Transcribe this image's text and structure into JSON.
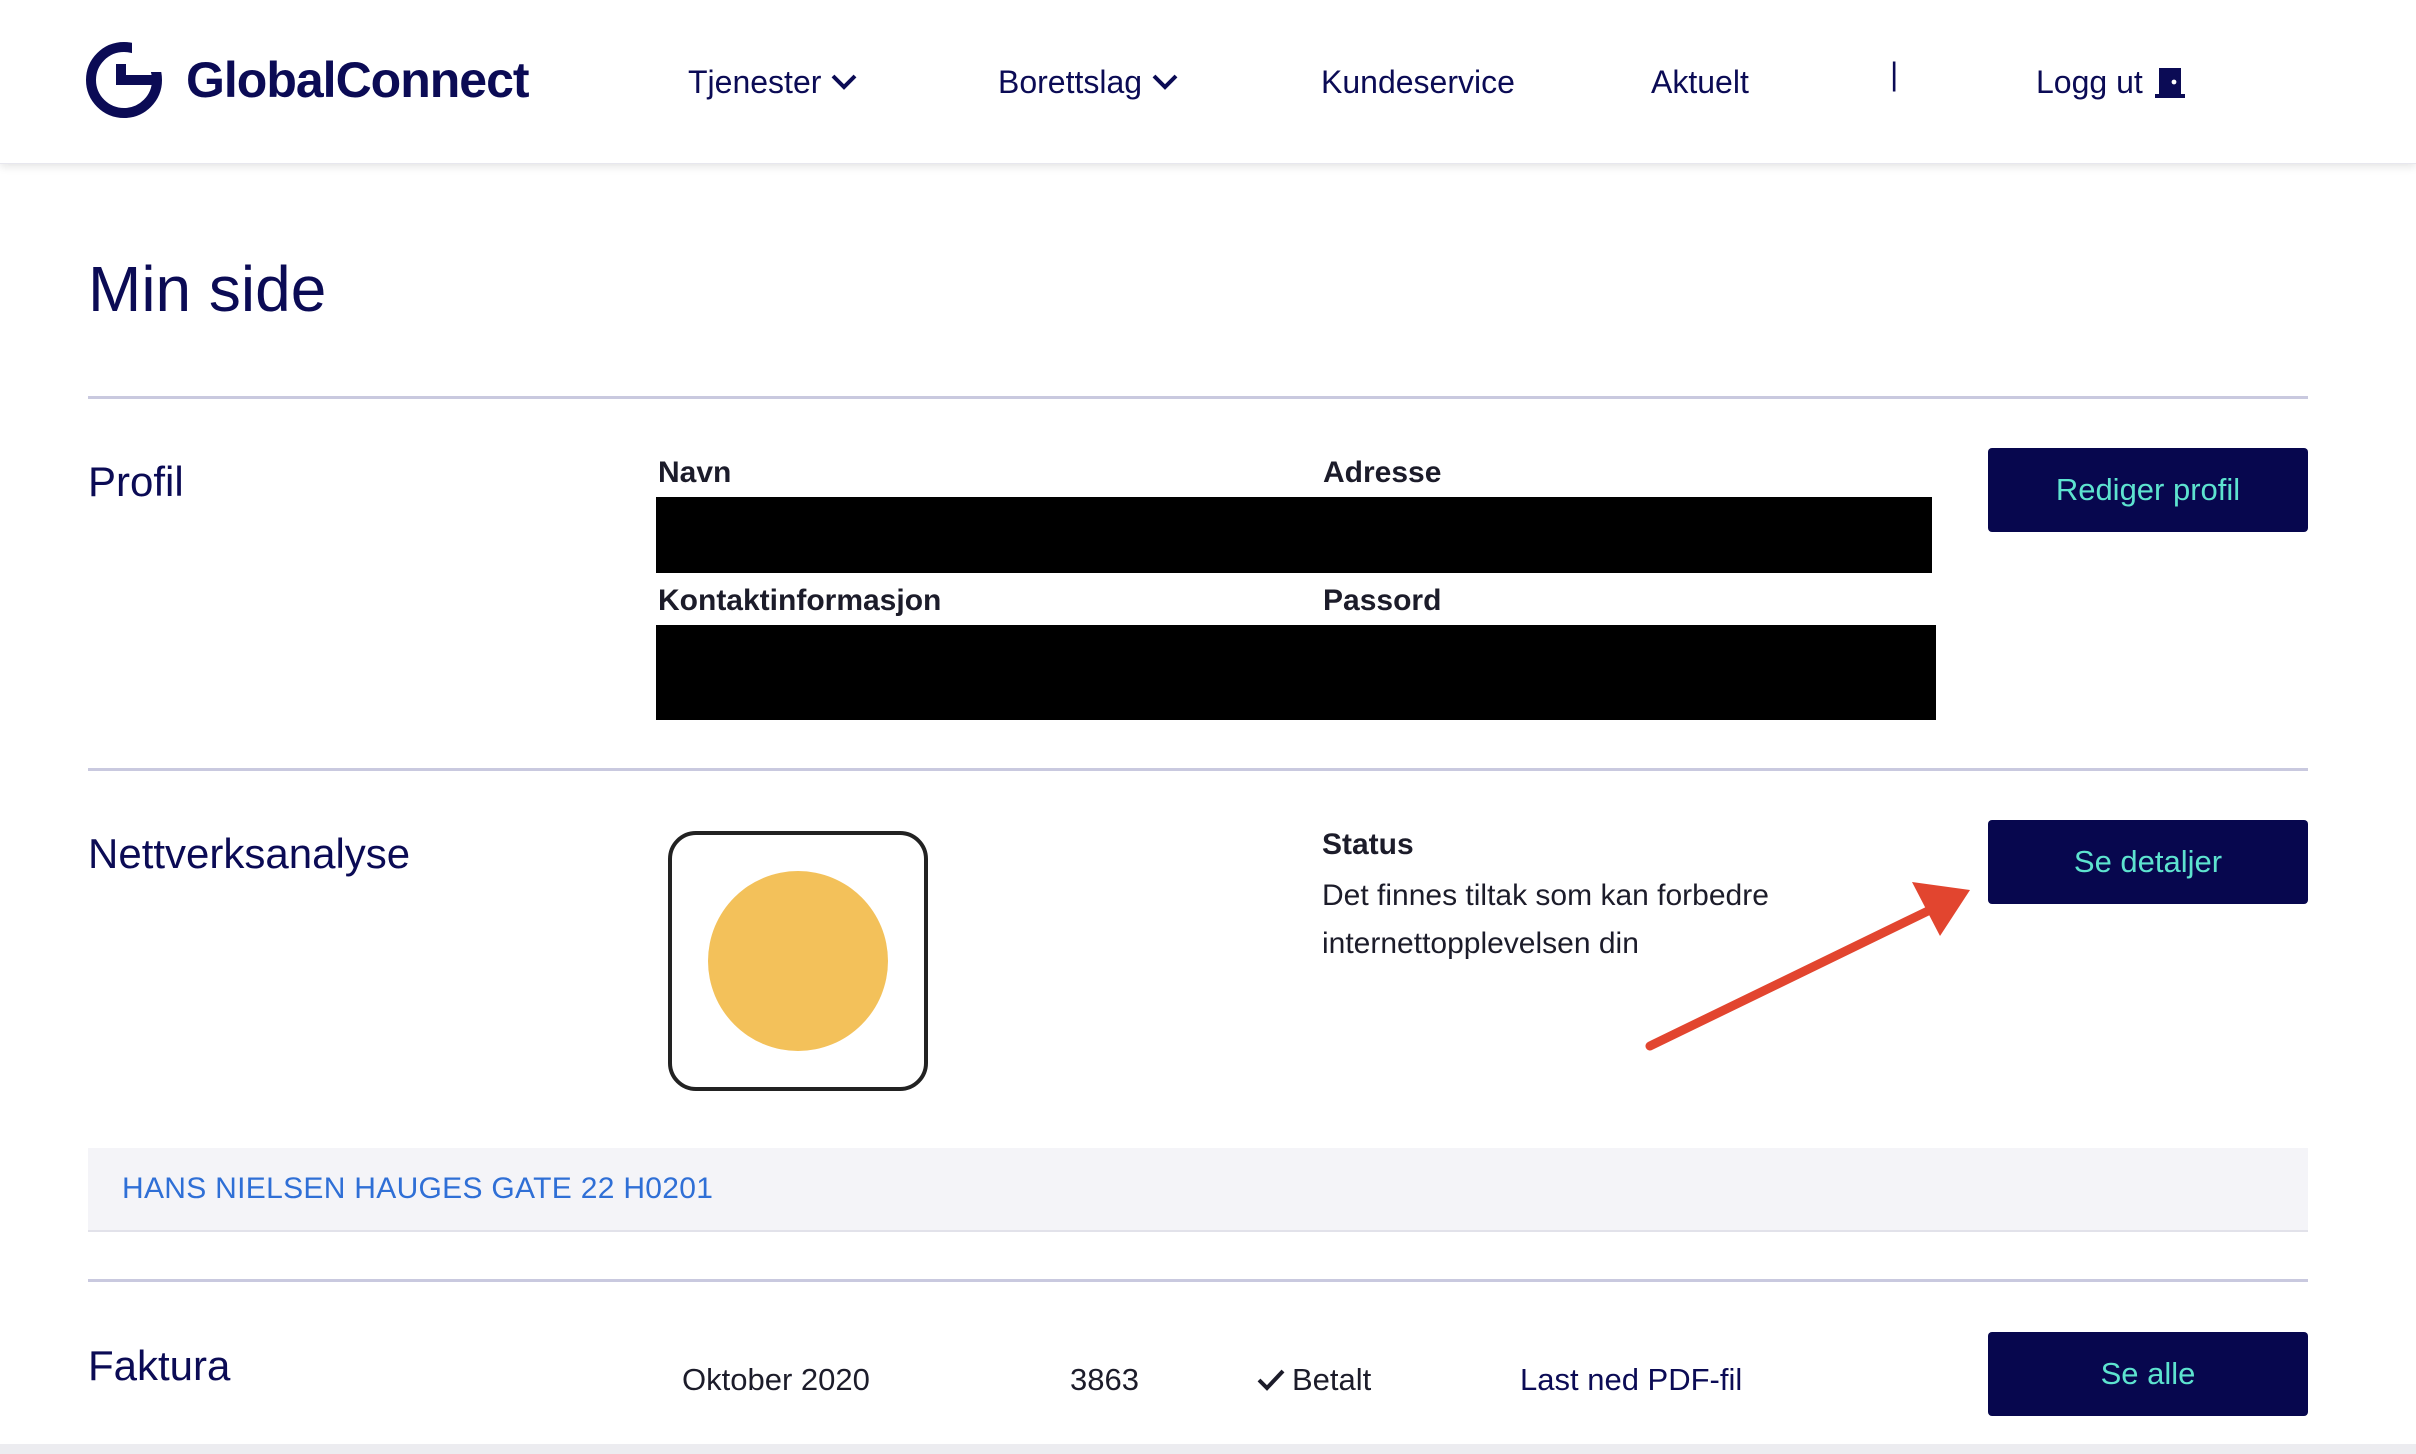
{
  "header": {
    "brand": "GlobalConnect",
    "nav": [
      {
        "label": "Tjenester",
        "has_dropdown": true
      },
      {
        "label": "Borettslag",
        "has_dropdown": true
      },
      {
        "label": "Kundeservice",
        "has_dropdown": false
      },
      {
        "label": "Aktuelt",
        "has_dropdown": false
      }
    ],
    "separator": "|",
    "logout_label": "Logg ut",
    "logout_icon": "door-exit-icon"
  },
  "page": {
    "title": "Min side"
  },
  "profile": {
    "section_title": "Profil",
    "labels": {
      "name": "Navn",
      "address": "Adresse",
      "contact": "Kontaktinformasjon",
      "password": "Passord"
    },
    "edit_button": "Rediger profil"
  },
  "network": {
    "section_title": "Nettverksanalyse",
    "status_label": "Status",
    "status_text": "Det finnes tiltak som kan forbedre internettopplevelsen din",
    "status_color": "#f3c15a",
    "details_button": "Se detaljer",
    "address": "HANS NIELSEN HAUGES GATE 22 H0201"
  },
  "invoice": {
    "section_title": "Faktura",
    "period": "Oktober 2020",
    "amount": "3863",
    "status": "Betalt",
    "download_label": "Last ned PDF-fil",
    "see_all_button": "Se alle"
  },
  "colors": {
    "brand_navy": "#0b0b55",
    "button_bg": "#07074e",
    "button_text": "#5de3cf",
    "link_blue": "#2f6fd6",
    "annotation_arrow": "#e2452f"
  }
}
